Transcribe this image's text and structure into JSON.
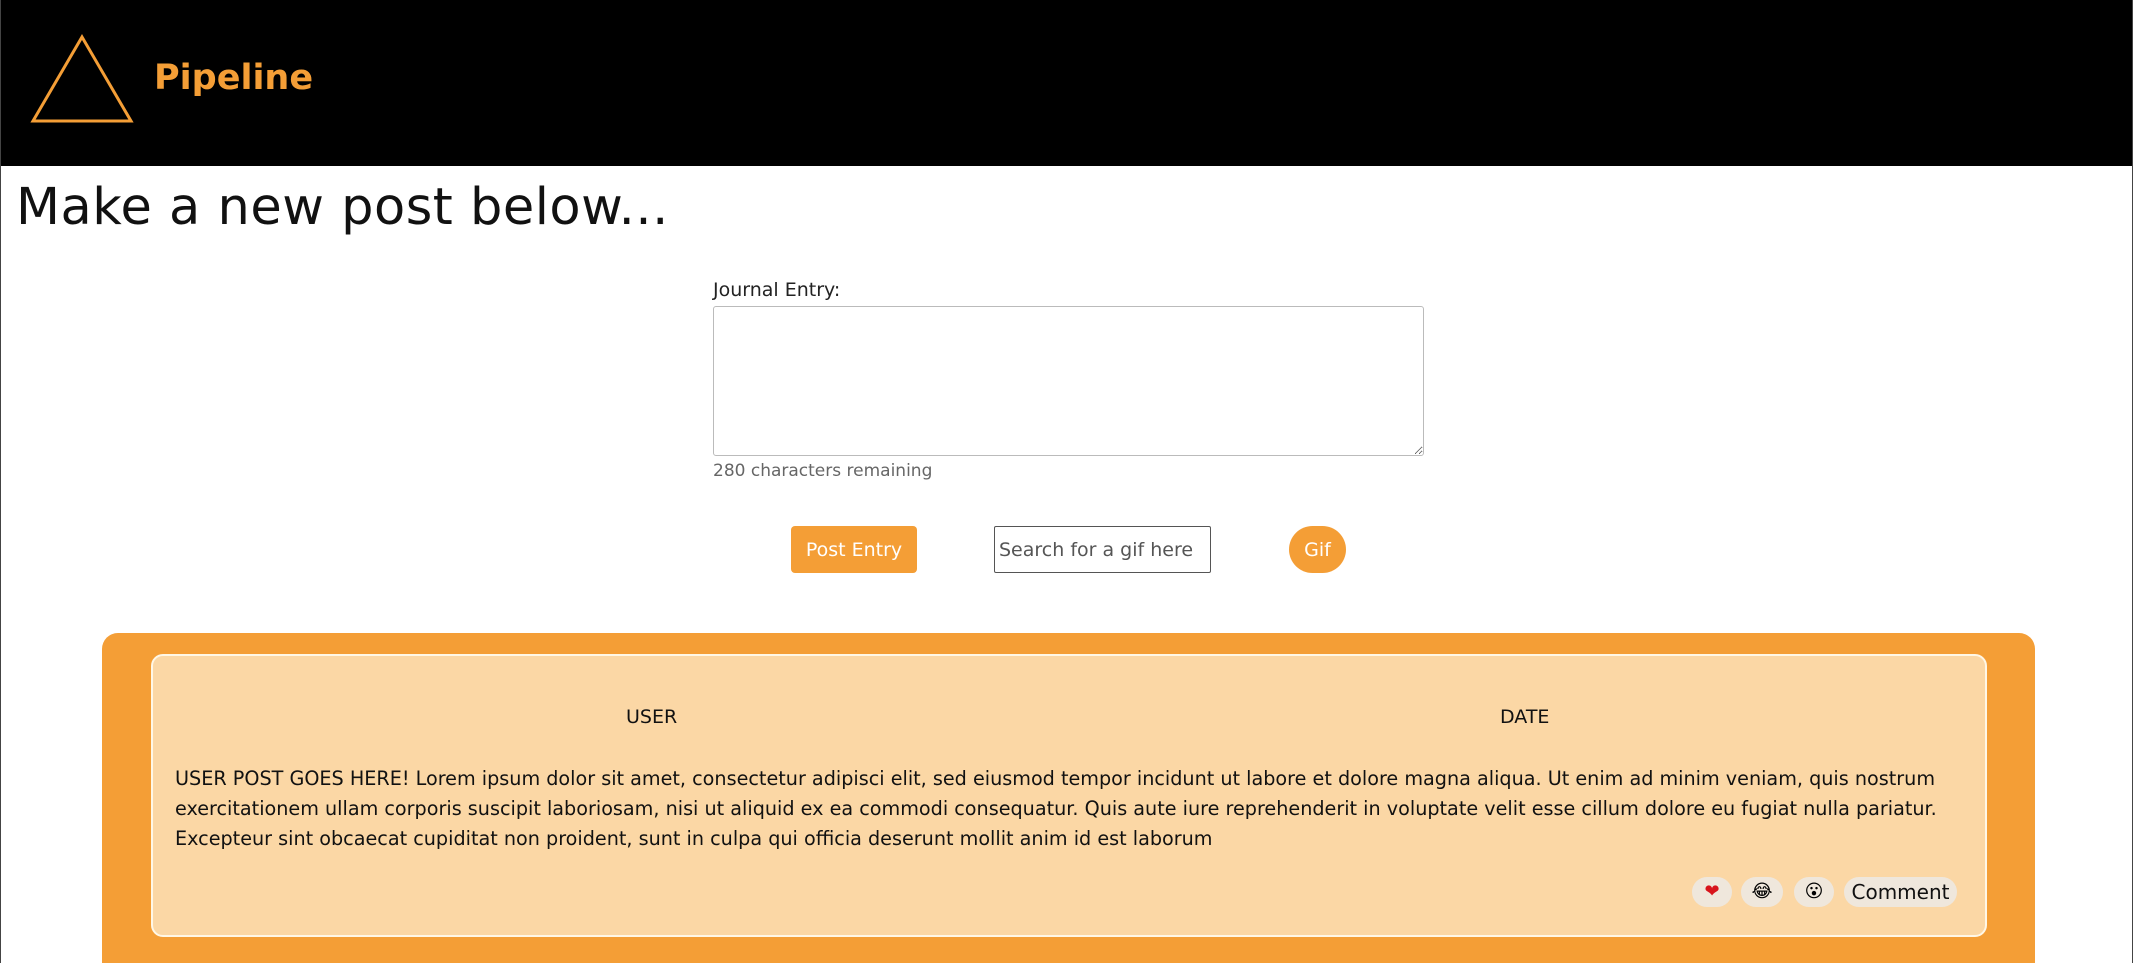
{
  "navbar": {
    "brand_name": "Pipeline",
    "brand_color": "#f49e36",
    "logo_icon": "triangle-icon"
  },
  "page": {
    "title": "Make a new post below..."
  },
  "form": {
    "journal_label": "Journal Entry:",
    "journal_value": "",
    "chars_remaining": "280 characters remaining",
    "post_button_label": "Post Entry",
    "gif_search_placeholder": "Search for a gif here",
    "gif_search_value": "",
    "gif_button_label": "Gif"
  },
  "feed": {
    "posts": [
      {
        "user": "USER",
        "date": "DATE",
        "body": "USER POST GOES HERE! Lorem ipsum dolor sit amet, consectetur adipisci elit, sed eiusmod tempor incidunt ut labore et dolore magna aliqua. Ut enim ad minim veniam, quis nostrum exercitationem ullam corporis suscipit laboriosam, nisi ut aliquid ex ea commodi consequatur. Quis aute iure reprehenderit in voluptate velit esse cillum dolore eu fugiat nulla pariatur. Excepteur sint obcaecat cupiditat non proident, sunt in culpa qui officia deserunt mollit anim id est laborum",
        "reactions": {
          "heart": "❤",
          "laugh": "😂",
          "wow": "😮",
          "comment_label": "Comment"
        }
      }
    ]
  },
  "colors": {
    "accent": "#f49e36",
    "card_background": "#fbd7a5",
    "navbar_background": "#000000"
  }
}
